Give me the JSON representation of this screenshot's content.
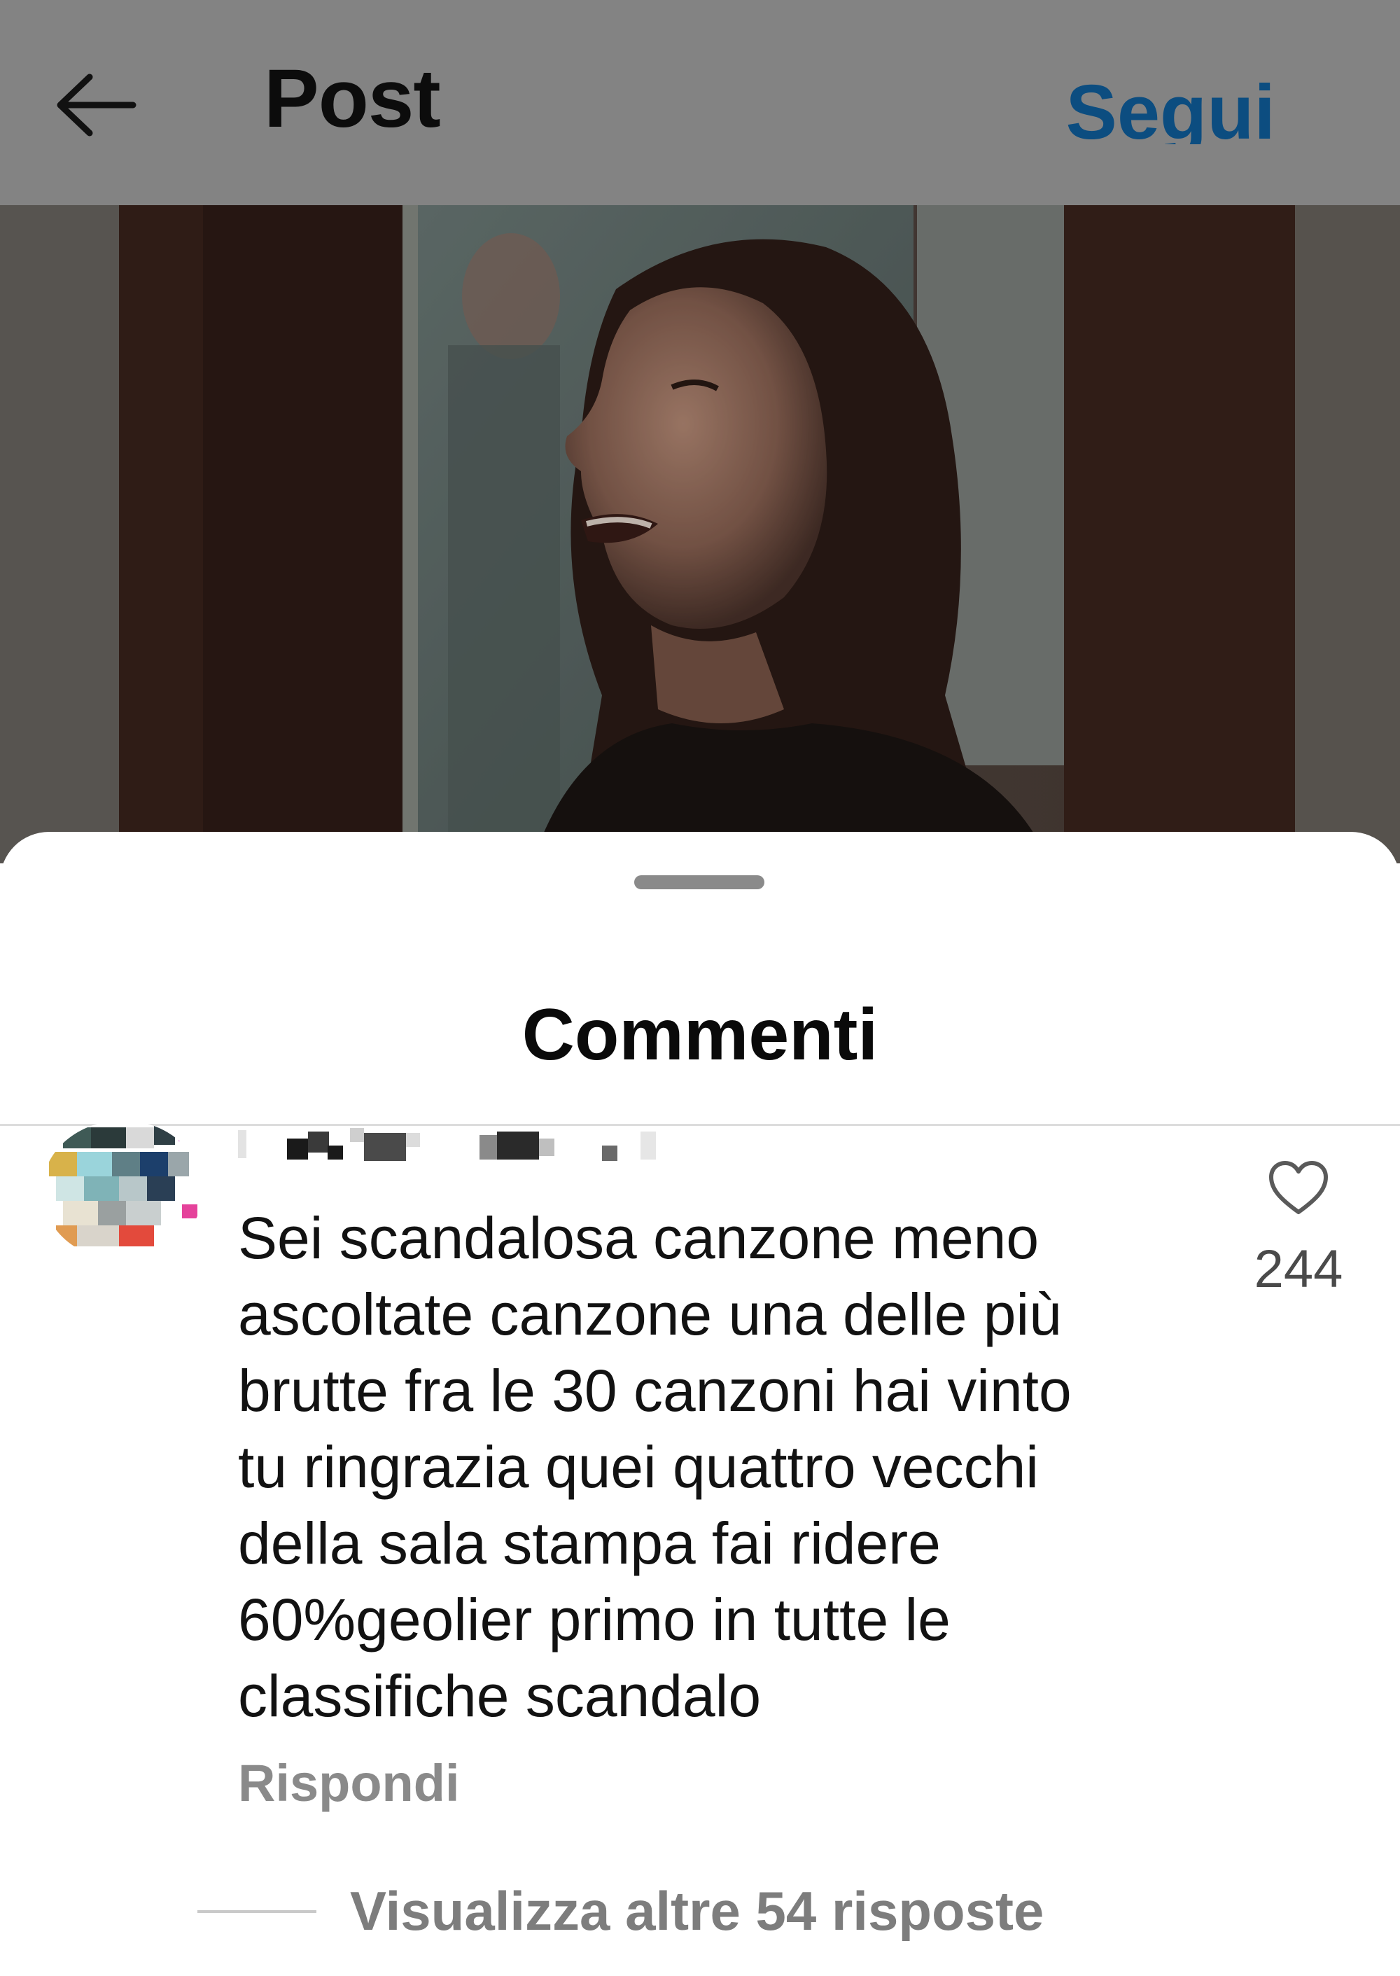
{
  "header": {
    "title": "Post",
    "follow_label": "Segui",
    "back_icon": "arrow-left-icon"
  },
  "post": {
    "image_alt": "Foto del post"
  },
  "comments_sheet": {
    "title": "Commenti"
  },
  "comment": {
    "username": "",
    "text": "Sei scandalosa canzone meno\nascoltate canzone una delle più\nbrutte fra le 30 canzoni hai vinto\ntu  ringrazia quei quattro vecchi\ndella sala stampa fai ridere\n60%geolier primo in tutte le\nclassifiche scandalo",
    "reply_label": "Rispondi",
    "like_icon": "heart-outline-icon",
    "like_count": "244",
    "view_replies_label": "Visualizza altre 54 risposte"
  },
  "colors": {
    "header_dim": "#838383",
    "follow_blue": "#0c4d80",
    "text_primary": "#121212",
    "text_secondary": "#8a8a8a"
  }
}
